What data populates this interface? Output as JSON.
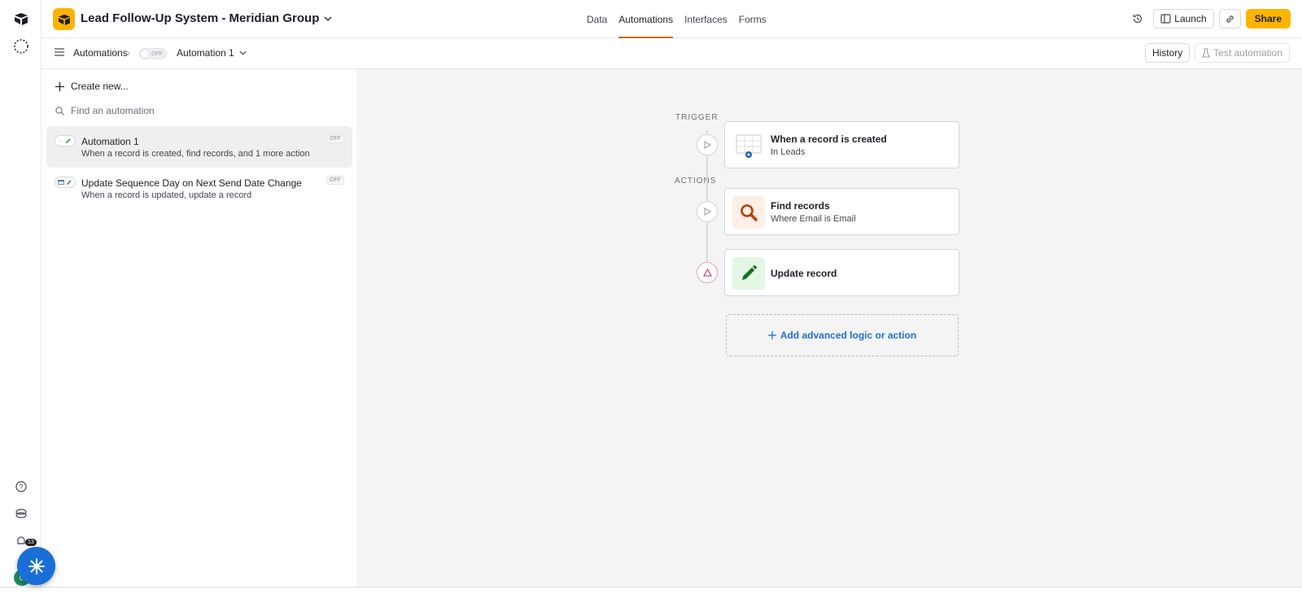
{
  "app": {
    "base_title": "Lead Follow-Up System - Meridian Group"
  },
  "nav": {
    "tabs": [
      {
        "label": "Data"
      },
      {
        "label": "Automations"
      },
      {
        "label": "Interfaces"
      },
      {
        "label": "Forms"
      }
    ],
    "active_tab": "Automations"
  },
  "top_actions": {
    "launch_label": "Launch",
    "share_label": "Share"
  },
  "subbar": {
    "breadcrumb_root": "Automations",
    "toggle_state": "OFF",
    "current_automation": "Automation 1",
    "history_label": "History",
    "test_label": "Test automation"
  },
  "sidebar": {
    "create_new_label": "Create new...",
    "search_placeholder": "Find an automation",
    "automations": [
      {
        "name": "Automation 1",
        "description": "When a record is created, find records, and 1 more action",
        "status": "OFF",
        "selected": true
      },
      {
        "name": "Update Sequence Day on Next Send Date Change",
        "description": "When a record is updated, update a record",
        "status": "OFF",
        "selected": false
      }
    ]
  },
  "flow": {
    "trigger_label": "TRIGGER",
    "actions_label": "ACTIONS",
    "trigger": {
      "title": "When a record is created",
      "subtitle": "In Leads"
    },
    "actions": [
      {
        "title": "Find records",
        "subtitle": "Where Email is Email"
      },
      {
        "title": "Update record",
        "subtitle": ""
      }
    ],
    "add_logic_label": "Add advanced logic or action"
  },
  "rail": {
    "notification_count": "13"
  },
  "colors": {
    "brand_yellow": "#fcb400",
    "active_tab_underline": "#c2711c",
    "link_blue": "#1d6fd0",
    "fab_blue": "#1a6fd6",
    "find_icon_bg": "#fdeee6",
    "update_icon_bg": "#e4f6e4"
  }
}
